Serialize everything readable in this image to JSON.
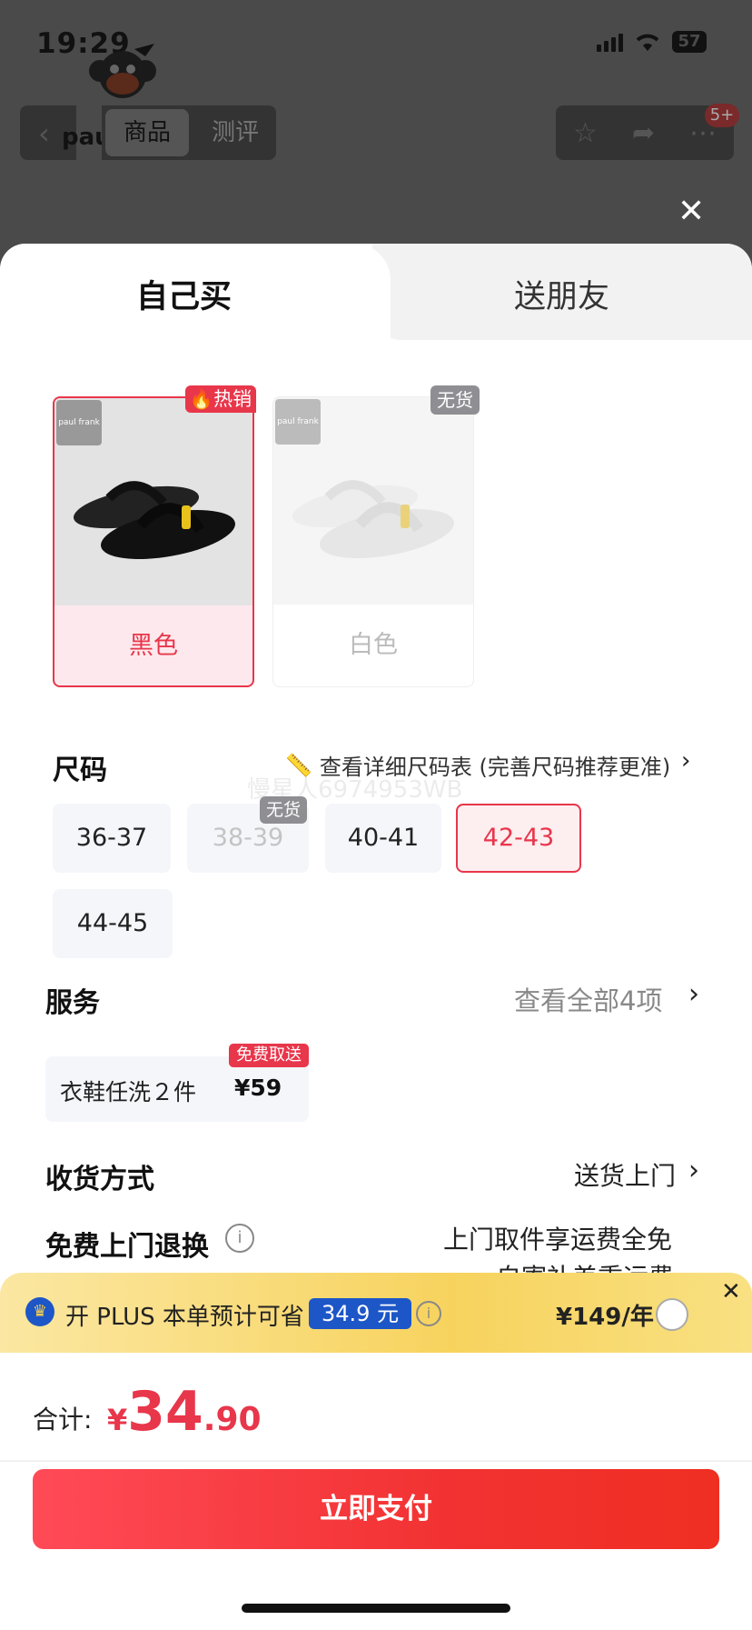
{
  "status": {
    "time": "19:29",
    "battery": "57"
  },
  "background_page": {
    "brand_fragment": "pau",
    "tabs": [
      "商品",
      "测评"
    ],
    "cart_badge": "5+"
  },
  "sheet": {
    "segments": {
      "self": "自己买",
      "friend": "送朋友"
    },
    "colors": [
      {
        "name": "黑色",
        "tag": "热销",
        "selected": true,
        "brand": "paul frank"
      },
      {
        "name": "白色",
        "tag": "无货",
        "selected": false,
        "brand": "paul frank"
      }
    ],
    "size": {
      "title": "尺码",
      "chart_link": "查看详细尺码表 (完善尺码推荐更准)",
      "watermark": "慢星人6974953WB",
      "options": [
        "36-37",
        "38-39",
        "40-41",
        "42-43",
        "44-45"
      ],
      "oos_tag": "无货",
      "selected": "42-43"
    },
    "service": {
      "title": "服务",
      "view_all": "查看全部4项",
      "item_name": "衣鞋任洗２件",
      "item_price": "¥59",
      "item_tag": "免费取送"
    },
    "shipping": {
      "title": "收货方式",
      "value": "送货上门"
    },
    "returns": {
      "title": "免费上门退换",
      "line1": "上门取件享运费全免",
      "line2": "自寄补差重运费"
    },
    "plus": {
      "text": "开 PLUS 本单预计可省",
      "amount": "34.9 元",
      "price": "¥149/年"
    },
    "total": {
      "label": "合计:",
      "currency": "¥",
      "integer": "34",
      "decimal": ".90"
    },
    "pay_button": "立即支付"
  },
  "colors": {
    "accent": "#e8364b",
    "plus_blue": "#1d56c7"
  }
}
